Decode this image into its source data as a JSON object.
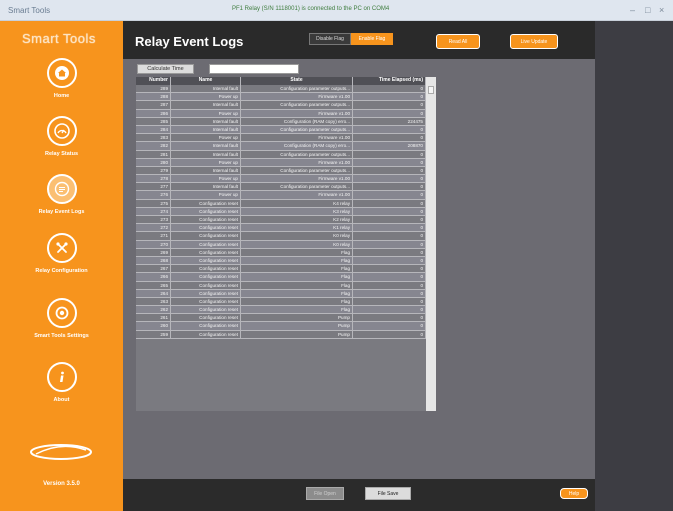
{
  "window": {
    "app_title": "Smart Tools",
    "status": "PF1 Relay (S/N 1118001) is connected to the PC on COM4",
    "controls": [
      "–",
      "□",
      "×"
    ]
  },
  "sidebar": {
    "brand": "Smart Tools",
    "brand_sub": "SMART TOOLS",
    "items": [
      {
        "label": "Home",
        "icon": "home-icon"
      },
      {
        "label": "Relay Status",
        "icon": "gauge-icon"
      },
      {
        "label": "Relay Event Logs",
        "icon": "logs-icon"
      },
      {
        "label": "Relay Configuration",
        "icon": "wrench-icon"
      },
      {
        "label": "Smart Tools Settings",
        "icon": "settings-icon"
      },
      {
        "label": "About",
        "icon": "info-icon"
      }
    ],
    "version": "Version 3.5.0"
  },
  "header": {
    "title": "Relay Event Logs",
    "seg_left": "Disable Flag",
    "seg_right": "Enable Flag",
    "btn_read": "Read All",
    "btn_live": "Live Update"
  },
  "toolbar": {
    "calculate_label": "Calculate Time",
    "calc_value": ""
  },
  "table": {
    "columns": [
      "Number",
      "Name",
      "State",
      "Time Elapsed (ms)"
    ],
    "rows": [
      [
        "289",
        "Internal fault",
        "Configuration parameter outputs...",
        "0"
      ],
      [
        "288",
        "Power up",
        "Firmware v1.00",
        "0"
      ],
      [
        "287",
        "Internal fault",
        "Configuration parameter outputs...",
        "0"
      ],
      [
        "286",
        "Power up",
        "Firmware v1.00",
        "0"
      ],
      [
        "285",
        "Internal fault",
        "Configuration (RAM copy) erro...",
        "224475"
      ],
      [
        "284",
        "Internal fault",
        "Configuration parameter outputs...",
        "0"
      ],
      [
        "283",
        "Power up",
        "Firmware v1.00",
        "0"
      ],
      [
        "282",
        "Internal fault",
        "Configuration (RAM copy) erro...",
        "208870"
      ],
      [
        "281",
        "Internal fault",
        "Configuration parameter outputs...",
        "0"
      ],
      [
        "280",
        "Power up",
        "Firmware v1.00",
        "0"
      ],
      [
        "279",
        "Internal fault",
        "Configuration parameter outputs...",
        "0"
      ],
      [
        "278",
        "Power up",
        "Firmware v1.00",
        "0"
      ],
      [
        "277",
        "Internal fault",
        "Configuration parameter outputs...",
        "0"
      ],
      [
        "276",
        "Power up",
        "Firmware v1.00",
        "0"
      ],
      [
        "275",
        "Configuration reset",
        "K4 relay",
        "0"
      ],
      [
        "274",
        "Configuration reset",
        "K3 relay",
        "0"
      ],
      [
        "273",
        "Configuration reset",
        "K2 relay",
        "0"
      ],
      [
        "272",
        "Configuration reset",
        "K1 relay",
        "0"
      ],
      [
        "271",
        "Configuration reset",
        "K0 relay",
        "0"
      ],
      [
        "270",
        "Configuration reset",
        "K0 relay",
        "0"
      ],
      [
        "269",
        "Configuration reset",
        "Flag",
        "0"
      ],
      [
        "268",
        "Configuration reset",
        "Flag",
        "0"
      ],
      [
        "267",
        "Configuration reset",
        "Flag",
        "0"
      ],
      [
        "266",
        "Configuration reset",
        "Flag",
        "0"
      ],
      [
        "265",
        "Configuration reset",
        "Flag",
        "0"
      ],
      [
        "264",
        "Configuration reset",
        "Flag",
        "0"
      ],
      [
        "263",
        "Configuration reset",
        "Flag",
        "0"
      ],
      [
        "262",
        "Configuration reset",
        "Flag",
        "0"
      ],
      [
        "261",
        "Configuration reset",
        "Pump",
        "0"
      ],
      [
        "260",
        "Configuration reset",
        "Pump",
        "0"
      ],
      [
        "259",
        "Configuration reset",
        "Pump",
        "0"
      ]
    ]
  },
  "footer": {
    "file_open": "File Open",
    "file_save": "File Save",
    "help": "Help"
  },
  "colors": {
    "sidebar_orange": "#f7941d",
    "header_dark": "#2a2a2a",
    "main_grey": "#6c6b72"
  }
}
